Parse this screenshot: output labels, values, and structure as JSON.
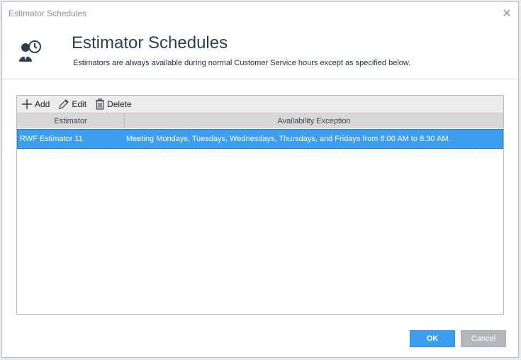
{
  "window": {
    "title": "Estimator Schedules",
    "close_icon": "close-icon"
  },
  "header": {
    "title": "Estimator Schedules",
    "subtitle": "Estimators are always available during normal Customer Service hours except as specified below.",
    "icon": "estimator-clock-icon"
  },
  "toolbar": {
    "add_label": "Add",
    "edit_label": "Edit",
    "delete_label": "Delete"
  },
  "grid": {
    "columns": [
      "Estimator",
      "Availability Exception"
    ],
    "rows": [
      {
        "estimator": "RWF Estimator 11",
        "exception": "Meeting Mondays, Tuesdays, Wednesdays, Thursdays, and Fridays from 8:00 AM to 8:30 AM.",
        "selected": true
      }
    ]
  },
  "footer": {
    "ok_label": "OK",
    "cancel_label": "Cancel"
  },
  "colors": {
    "accent": "#3d9ef0",
    "title_text": "#2c3e50",
    "cancel_bg": "#b4b7bb"
  }
}
